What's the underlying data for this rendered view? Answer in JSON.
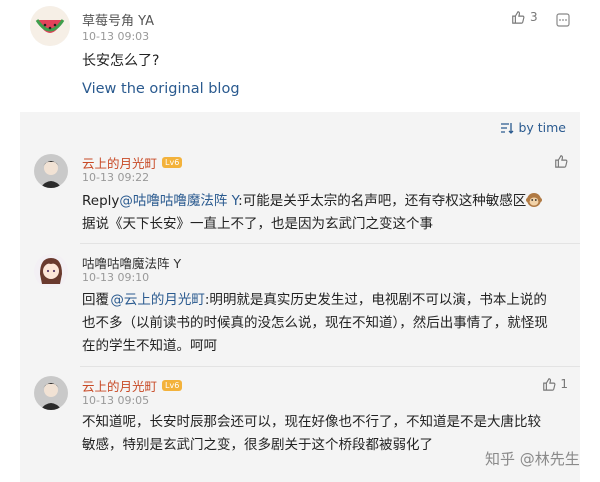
{
  "top_comment": {
    "author": "草莓号角 YA",
    "time": "10-13 09:03",
    "likes": "3",
    "text": "长安怎么了?",
    "view_original": "View the original blog"
  },
  "panel": {
    "sort_label": "by time"
  },
  "replies": [
    {
      "author": "云上的月光町",
      "badge": "Lv6",
      "time": "10-13 09:22",
      "likes": "",
      "reply_prefix": "Reply",
      "mention": "@咕噜咕噜魔法阵 Y",
      "text_a": ":可能是关乎太宗的名声吧，还有夺权这种敏感区",
      "text_b": "据说《天下长安》一直上不了，也是因为玄武门之变这个事"
    },
    {
      "author": "咕噜咕噜魔法阵 Y",
      "time": "10-13 09:10",
      "reply_prefix": "回覆",
      "mention": "@云上的月光町",
      "text": ":明明就是真实历史发生过，电视剧不可以演，书本上说的也不多（以前读书的时候真的没怎么说，现在不知道），然后出事情了，就怪现在的学生不知道。呵呵"
    },
    {
      "author": "云上的月光町",
      "badge": "Lv6",
      "time": "10-13 09:05",
      "likes": "1",
      "text": "不知道呢，长安时辰那会还可以，现在好像也不行了，不知道是不是大唐比较敏感，特别是玄武门之变，很多剧关于这个桥段都被弱化了"
    }
  ],
  "watermark": "知乎 @林先生"
}
